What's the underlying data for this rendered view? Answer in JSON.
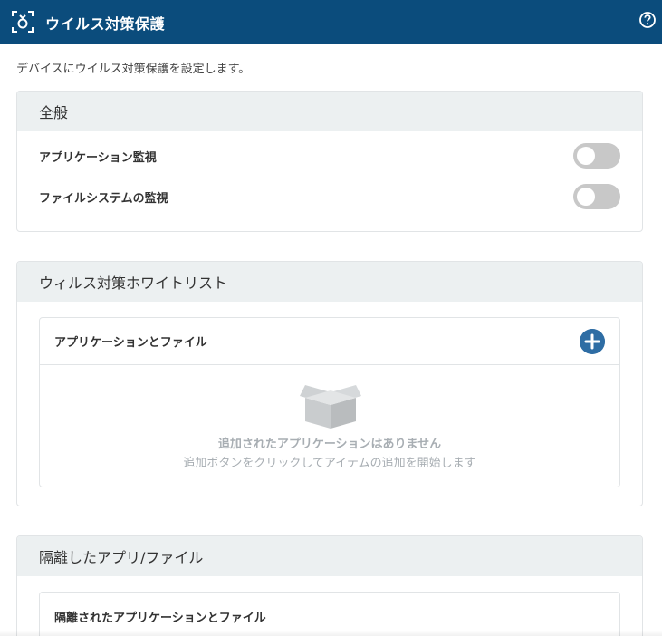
{
  "header": {
    "title": "ウイルス対策保護",
    "help_icon": "help-circle-icon",
    "app_icon": "antivirus-scan-icon",
    "background": "#0b4c7c"
  },
  "description": "デバイスにウイルス対策保護を設定します。",
  "general": {
    "title": "全般",
    "items": [
      {
        "label": "アプリケーション監視",
        "enabled": false
      },
      {
        "label": "ファイルシステムの監視",
        "enabled": false
      }
    ]
  },
  "whitelist": {
    "title": "ウィルス対策ホワイトリスト",
    "panel_title": "アプリケーションとファイル",
    "add_icon": "plus-circle-icon",
    "empty_icon": "open-box-icon",
    "empty_title": "追加されたアプリケーションはありません",
    "empty_subtitle": "追加ボタンをクリックしてアイテムの追加を開始します"
  },
  "quarantine": {
    "title": "隔離したアプリ/ファイル",
    "panel_title": "隔離されたアプリケーションとファイル"
  }
}
